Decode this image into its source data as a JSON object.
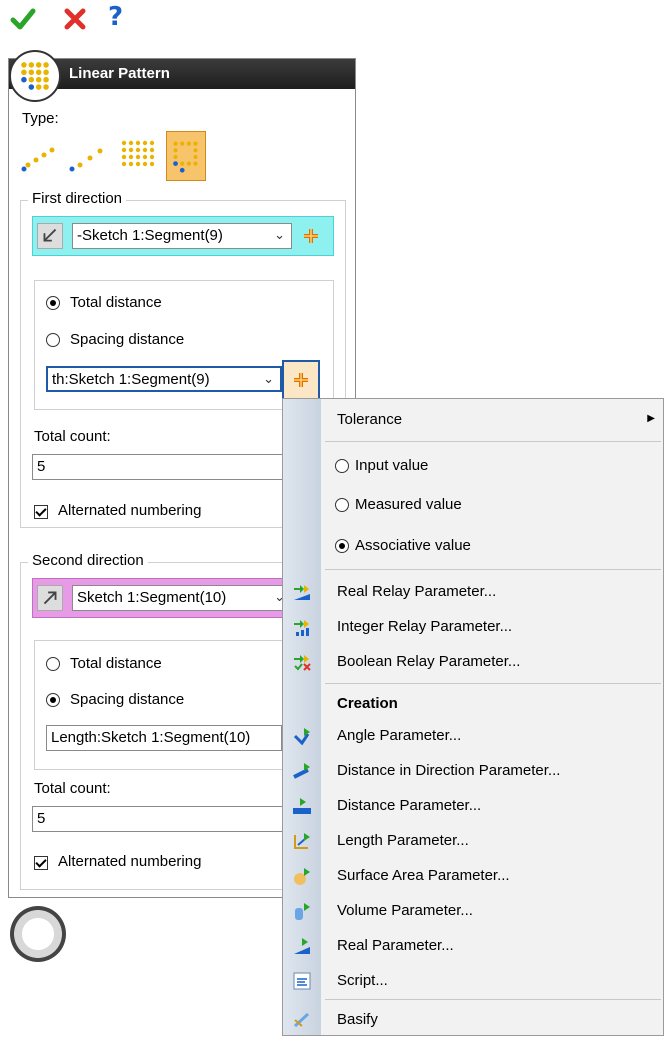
{
  "toolbar": {
    "ok_icon": "check-icon",
    "cancel_icon": "close-icon",
    "help_label": "?"
  },
  "dialog": {
    "title": "Linear Pattern",
    "type_label": "Type:",
    "first_direction": {
      "title": "First direction",
      "geometry": "-Sketch 1:Segment(9)",
      "total_distance_label": "Total distance",
      "spacing_distance_label": "Spacing distance",
      "distance_value": "th:Sketch 1:Segment(9)",
      "total_count_label": "Total count:",
      "total_count": "5",
      "alternated_label": "Alternated numbering"
    },
    "second_direction": {
      "title": "Second direction",
      "geometry": "Sketch 1:Segment(10)",
      "total_distance_label": "Total distance",
      "spacing_distance_label": "Spacing distance",
      "distance_value": "Length:Sketch 1:Segment(10)",
      "total_count_label": "Total count:",
      "total_count": "5",
      "alternated_label": "Alternated numbering"
    }
  },
  "menu": {
    "tolerance": "Tolerance",
    "input_value": "Input value",
    "measured_value": "Measured value",
    "associative_value": "Associative value",
    "real_relay": "Real Relay Parameter...",
    "integer_relay": "Integer Relay Parameter...",
    "boolean_relay": "Boolean Relay Parameter...",
    "creation": "Creation",
    "angle": "Angle Parameter...",
    "distance_direction": "Distance in Direction Parameter...",
    "distance": "Distance Parameter...",
    "length": "Length Parameter...",
    "surface_area": "Surface Area Parameter...",
    "volume": "Volume Parameter...",
    "real": "Real Parameter...",
    "script": "Script...",
    "basify": "Basify"
  },
  "colors": {
    "first_dir_highlight": "#8ff0f0",
    "second_dir_highlight": "#e79be7",
    "accent": "#1a62c9"
  }
}
